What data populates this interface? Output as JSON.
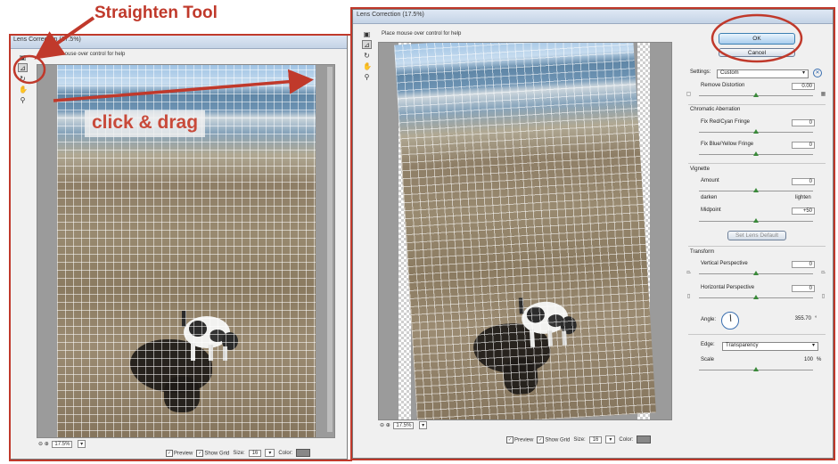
{
  "annotations": {
    "straighten_tool": "Straighten Tool",
    "click_drag": "click & drag"
  },
  "colors": {
    "annotation_red": "#c0392b",
    "ok_button": "#a9cdee",
    "slider_knob": "#3a8a3a"
  },
  "left_window": {
    "title": "Lens Correction (17.5%)",
    "hint": "Place mouse over control for help",
    "tools": [
      "remove-distortion-icon",
      "straighten-icon",
      "move-grid-icon",
      "hand-icon",
      "zoom-icon"
    ],
    "zoom_value": "17.5%",
    "preview_label": "Preview",
    "show_grid_label": "Show Grid",
    "size_label": "Size:",
    "size_value": "16",
    "color_label": "Color:"
  },
  "right_window": {
    "title": "Lens Correction (17.5%)",
    "hint": "Place mouse over control for help",
    "zoom_value": "17.5%",
    "preview_label": "Preview",
    "show_grid_label": "Show Grid",
    "size_label": "Size:",
    "size_value": "16",
    "color_label": "Color:"
  },
  "panel": {
    "ok_label": "OK",
    "cancel_label": "Cancel",
    "settings_label": "Settings:",
    "settings_value": "Custom",
    "remove_distortion_label": "Remove Distortion",
    "remove_distortion_value": "0.00",
    "chromatic_aberration_label": "Chromatic Aberration",
    "fix_red_cyan_label": "Fix Red/Cyan Fringe",
    "fix_red_cyan_value": "0",
    "fix_blue_yellow_label": "Fix Blue/Yellow Fringe",
    "fix_blue_yellow_value": "0",
    "vignette_label": "Vignette",
    "amount_label": "Amount",
    "amount_value": "0",
    "darken_label": "darken",
    "lighten_label": "lighten",
    "midpoint_label": "Midpoint",
    "midpoint_value": "+50",
    "set_lens_default_label": "Set Lens Default",
    "transform_label": "Transform",
    "vertical_perspective_label": "Vertical Perspective",
    "vertical_perspective_value": "0",
    "horizontal_perspective_label": "Horizontal Perspective",
    "horizontal_perspective_value": "0",
    "angle_label": "Angle:",
    "angle_value": "355.70",
    "angle_unit": "°",
    "edge_label": "Edge:",
    "edge_value": "Transparency",
    "scale_label": "Scale",
    "scale_value": "100",
    "scale_unit": "%"
  }
}
